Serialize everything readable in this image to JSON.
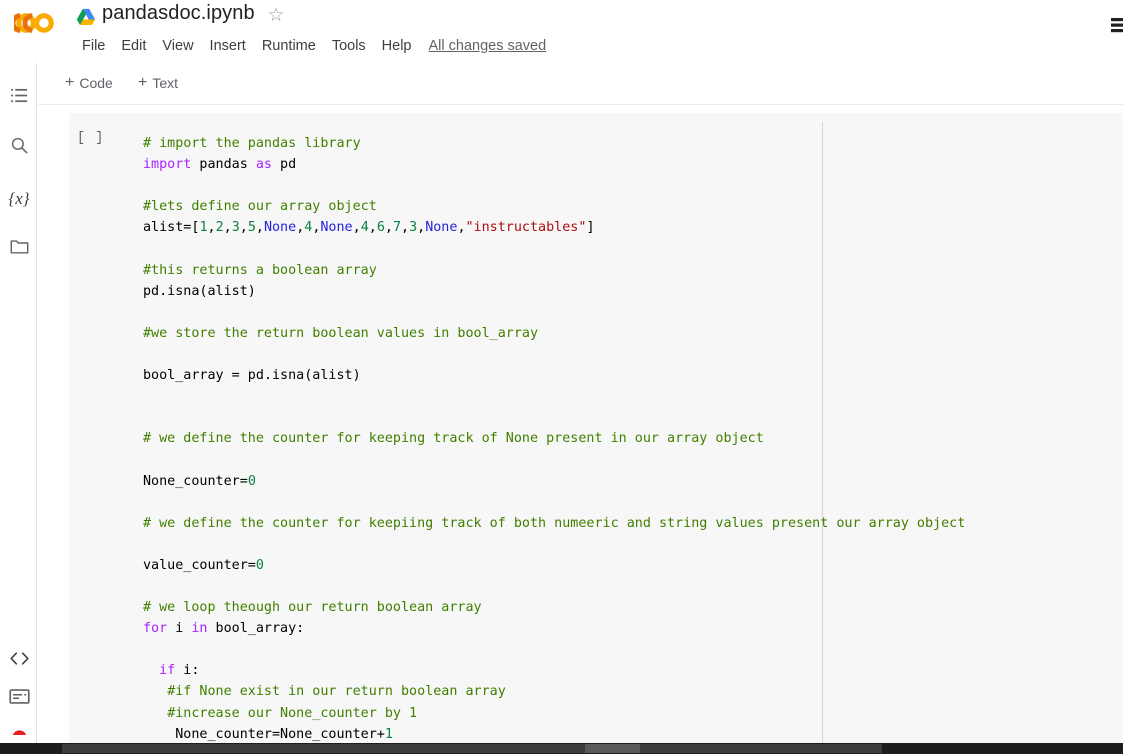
{
  "header": {
    "logo_name": "colab-logo",
    "drive_icon": "google-drive-icon",
    "title": "pandasdoc.ipynb",
    "star_glyph": "☆",
    "menus": [
      "File",
      "Edit",
      "View",
      "Insert",
      "Runtime",
      "Tools",
      "Help"
    ],
    "save_status": "All changes saved"
  },
  "sidebar": {
    "items": [
      {
        "name": "table-of-contents",
        "icon": "list-icon"
      },
      {
        "name": "find-and-replace",
        "icon": "search-icon"
      },
      {
        "name": "variables",
        "icon": "variables-icon",
        "glyph": "{x}"
      },
      {
        "name": "files",
        "icon": "folder-icon"
      },
      {
        "name": "code-snippets",
        "icon": "code-brackets-icon",
        "glyph": "‹›"
      },
      {
        "name": "terminal",
        "icon": "terminal-icon"
      },
      {
        "name": "record",
        "icon": "record-dot-icon"
      }
    ]
  },
  "toolbar": {
    "add_code_label": "Code",
    "add_text_label": "Text",
    "plus_glyph": "+"
  },
  "cell": {
    "run_gutter_label": "[ ]",
    "lines": [
      [
        {
          "t": "comment",
          "s": "# import the pandas library"
        }
      ],
      [
        {
          "t": "keyword",
          "s": "import"
        },
        {
          "t": "plain",
          "s": " pandas "
        },
        {
          "t": "keyword",
          "s": "as"
        },
        {
          "t": "plain",
          "s": " pd"
        }
      ],
      [
        {
          "t": "plain",
          "s": ""
        }
      ],
      [
        {
          "t": "comment",
          "s": "#lets define our array object"
        }
      ],
      [
        {
          "t": "plain",
          "s": "alist=["
        },
        {
          "t": "number",
          "s": "1"
        },
        {
          "t": "plain",
          "s": ","
        },
        {
          "t": "number",
          "s": "2"
        },
        {
          "t": "plain",
          "s": ","
        },
        {
          "t": "number",
          "s": "3"
        },
        {
          "t": "plain",
          "s": ","
        },
        {
          "t": "number",
          "s": "5"
        },
        {
          "t": "plain",
          "s": ","
        },
        {
          "t": "none",
          "s": "None"
        },
        {
          "t": "plain",
          "s": ","
        },
        {
          "t": "number",
          "s": "4"
        },
        {
          "t": "plain",
          "s": ","
        },
        {
          "t": "none",
          "s": "None"
        },
        {
          "t": "plain",
          "s": ","
        },
        {
          "t": "number",
          "s": "4"
        },
        {
          "t": "plain",
          "s": ","
        },
        {
          "t": "number",
          "s": "6"
        },
        {
          "t": "plain",
          "s": ","
        },
        {
          "t": "number",
          "s": "7"
        },
        {
          "t": "plain",
          "s": ","
        },
        {
          "t": "number",
          "s": "3"
        },
        {
          "t": "plain",
          "s": ","
        },
        {
          "t": "none",
          "s": "None"
        },
        {
          "t": "plain",
          "s": ","
        },
        {
          "t": "string",
          "s": "\"instructables\""
        },
        {
          "t": "plain",
          "s": "]"
        }
      ],
      [
        {
          "t": "plain",
          "s": ""
        }
      ],
      [
        {
          "t": "comment",
          "s": "#this returns a boolean array"
        }
      ],
      [
        {
          "t": "plain",
          "s": "pd.isna(alist)"
        }
      ],
      [
        {
          "t": "plain",
          "s": ""
        }
      ],
      [
        {
          "t": "comment",
          "s": "#we store the return boolean values in bool_array"
        }
      ],
      [
        {
          "t": "plain",
          "s": ""
        }
      ],
      [
        {
          "t": "plain",
          "s": "bool_array = pd.isna(alist)"
        }
      ],
      [
        {
          "t": "plain",
          "s": ""
        }
      ],
      [
        {
          "t": "plain",
          "s": ""
        }
      ],
      [
        {
          "t": "comment",
          "s": "# we define the counter for keeping track of None present in our array object"
        }
      ],
      [
        {
          "t": "plain",
          "s": ""
        }
      ],
      [
        {
          "t": "plain",
          "s": "None_counter="
        },
        {
          "t": "number",
          "s": "0"
        }
      ],
      [
        {
          "t": "plain",
          "s": ""
        }
      ],
      [
        {
          "t": "comment",
          "s": "# we define the counter for keepiing track of both numeeric and string values present our array object"
        }
      ],
      [
        {
          "t": "plain",
          "s": ""
        }
      ],
      [
        {
          "t": "plain",
          "s": "value_counter="
        },
        {
          "t": "number",
          "s": "0"
        }
      ],
      [
        {
          "t": "plain",
          "s": ""
        }
      ],
      [
        {
          "t": "comment",
          "s": "# we loop theough our return boolean array"
        }
      ],
      [
        {
          "t": "keyword",
          "s": "for"
        },
        {
          "t": "plain",
          "s": " i "
        },
        {
          "t": "keyword",
          "s": "in"
        },
        {
          "t": "plain",
          "s": " bool_array:"
        }
      ],
      [
        {
          "t": "plain",
          "s": ""
        }
      ],
      [
        {
          "t": "plain",
          "s": "  "
        },
        {
          "t": "keyword",
          "s": "if"
        },
        {
          "t": "plain",
          "s": " i:"
        }
      ],
      [
        {
          "t": "plain",
          "s": "   "
        },
        {
          "t": "comment",
          "s": "#if None exist in our return boolean array"
        }
      ],
      [
        {
          "t": "plain",
          "s": "   "
        },
        {
          "t": "comment",
          "s": "#increase our None_counter by 1"
        }
      ],
      [
        {
          "t": "plain",
          "s": "    None_counter=None_counter+"
        },
        {
          "t": "number",
          "s": "1"
        }
      ]
    ]
  },
  "scrollbar": {
    "name": "horizontal-scrollbar"
  }
}
